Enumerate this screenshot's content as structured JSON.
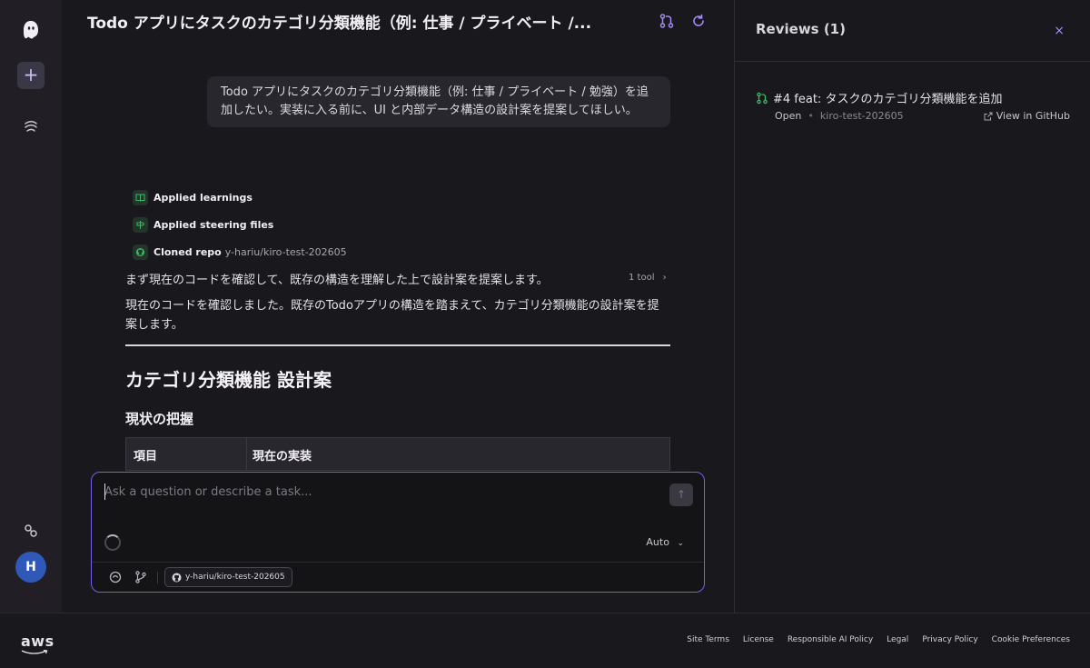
{
  "header": {
    "title": "Todo アプリにタスクのカテゴリ分類機能（例: 仕事 / プライベート /..."
  },
  "rail": {
    "new_label": "+",
    "avatar": "H"
  },
  "conversation": {
    "user_message": "Todo アプリにタスクのカテゴリ分類機能（例: 仕事 / プライベート / 勉強）を追加したい。実装に入る前に、UI と内部データ構造の設計案を提案してほしい。",
    "steps": [
      {
        "label": "Applied learnings",
        "sub": ""
      },
      {
        "label": "Applied steering files",
        "sub": ""
      },
      {
        "label": "Cloned repo",
        "sub": "y-hariu/kiro-test-202605"
      }
    ],
    "para1": "まず現在のコードを確認して、既存の構造を理解した上で設計案を提案します。",
    "tool_count": "1 tool",
    "para2": "現在のコードを確認しました。既存のTodoアプリの構造を踏まえて、カテゴリ分類機能の設計案を提案します。",
    "h2": "カテゴリ分類機能 設計案",
    "h3": "現状の把握",
    "table_headers": [
      "項目",
      "現在の実装"
    ]
  },
  "chat": {
    "placeholder": "Ask a question or describe a task...",
    "mode": "Auto",
    "repo_chip": "y-hariu/kiro-test-202605"
  },
  "reviews": {
    "title": "Reviews (1)",
    "close": "×",
    "pr_title": "#4 feat: タスクのカテゴリ分類機能を追加",
    "status": "Open",
    "branch": "kiro-test-202605",
    "link": "View in GitHub"
  },
  "footer": {
    "logo": "aws",
    "links": [
      "Site Terms",
      "License",
      "Responsible AI Policy",
      "Legal",
      "Privacy Policy",
      "Cookie Preferences"
    ]
  },
  "colors": {
    "accent": "#7b5cf0",
    "avatar": "#2f58b8",
    "success": "#3fb868"
  }
}
